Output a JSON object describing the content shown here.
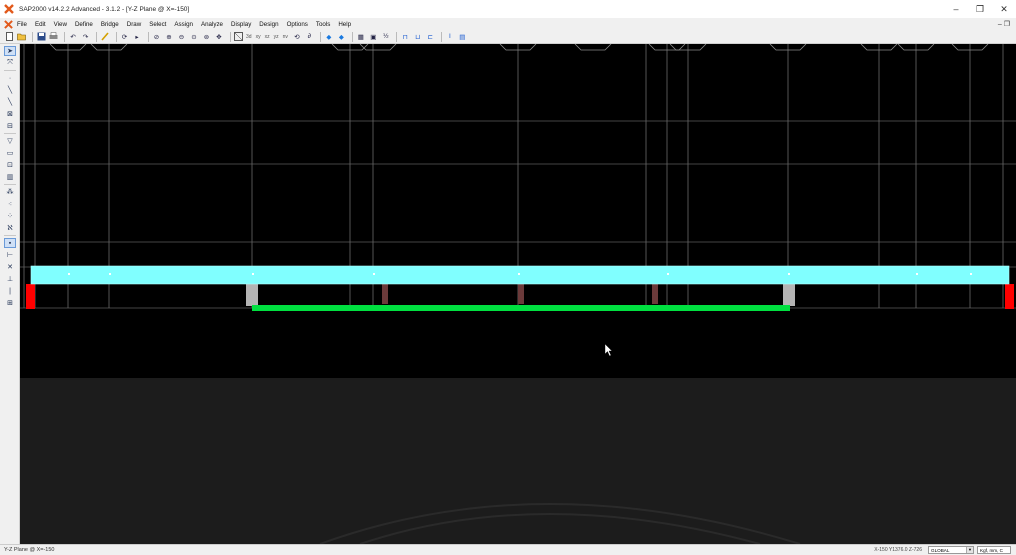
{
  "window": {
    "title": "SAP2000 v14.2.2 Advanced  - 3.1.2 - [Y-Z Plane @ X=-150]",
    "controls": [
      "–",
      "❐",
      "✕"
    ],
    "doc_controls": "– ❐"
  },
  "menu": [
    "File",
    "Edit",
    "View",
    "Define",
    "Bridge",
    "Draw",
    "Select",
    "Assign",
    "Analyze",
    "Display",
    "Design",
    "Options",
    "Tools",
    "Help"
  ],
  "toolbar": {
    "view_labels": [
      "3d",
      "xy",
      "xz",
      "yz",
      "nv"
    ]
  },
  "statusbar": {
    "view_label": "Y-Z Plane @ X=-150",
    "coordinates": "X-150  Y1376.0  Z-726",
    "coord_system": "GLOBAL",
    "units": "Kgf, mm, C"
  },
  "colors": {
    "deck": "#80FFFF",
    "green_member": "#00E040",
    "support_red": "#FF0000",
    "support_gray": "#B4B4B4",
    "post_brown": "#6B3A3A",
    "grid": "#5A5A5A",
    "lower_panel": "#1C1C1C"
  },
  "icons": [
    "app-logo-icon",
    "new-icon",
    "open-icon",
    "save-icon",
    "print-icon",
    "undo-icon",
    "redo-icon",
    "refresh-icon",
    "lock-icon",
    "run-icon",
    "rubber-band-zoom-icon",
    "zoom-in-icon",
    "zoom-out-icon",
    "pan-icon",
    "3d-view-icon",
    "pointer-icon"
  ]
}
